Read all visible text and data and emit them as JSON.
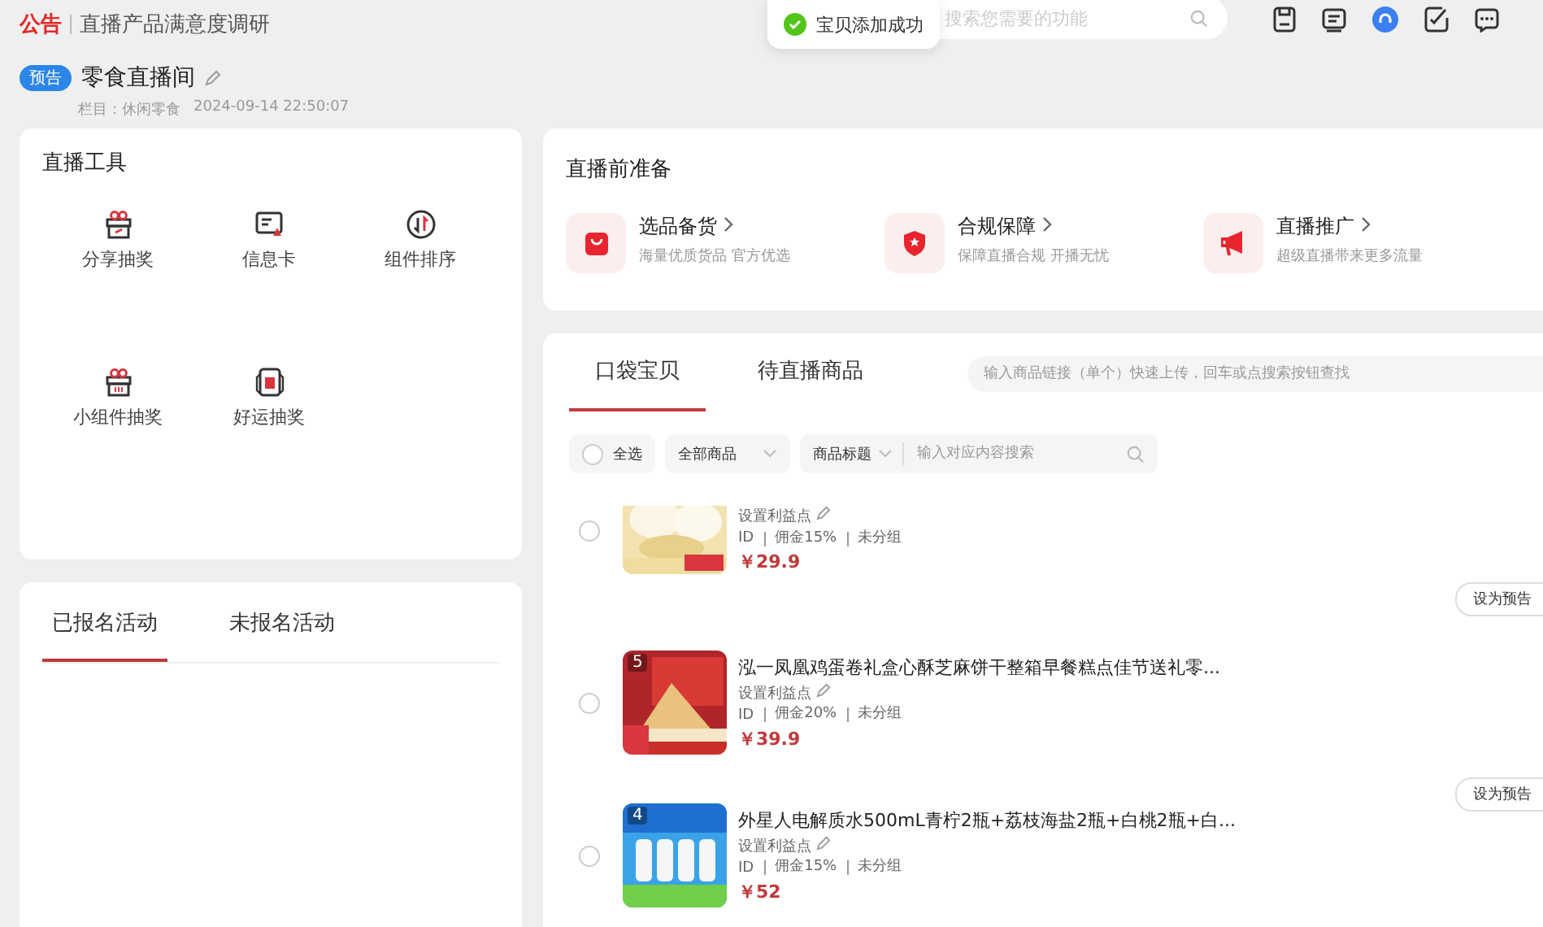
{
  "notice": {
    "tag": "公告",
    "text": "直播产品满意度调研"
  },
  "toast": {
    "text": "宝贝添加成功"
  },
  "search": {
    "placeholder": "搜索您需要的功能"
  },
  "toolbar_icons": [
    {
      "kind": "save"
    },
    {
      "kind": "message"
    },
    {
      "kind": "support"
    },
    {
      "kind": "edit"
    },
    {
      "kind": "chat"
    }
  ],
  "room": {
    "badge": "预告",
    "title": "零食直播间",
    "category": "栏目：休闲零食",
    "time": "2024-09-14 22:50:07"
  },
  "tools": {
    "title": "直播工具",
    "items": [
      {
        "kind": "gift",
        "label": "分享抽奖"
      },
      {
        "kind": "card",
        "label": "信息卡"
      },
      {
        "kind": "sort",
        "label": "组件排序"
      },
      {
        "kind": "gift2",
        "label": "小组件抽奖"
      },
      {
        "kind": "lucky",
        "label": "好运抽奖"
      }
    ]
  },
  "activities": {
    "tabs": [
      {
        "label": "已报名活动",
        "selected": true
      },
      {
        "label": "未报名活动",
        "selected": false
      }
    ]
  },
  "prep": {
    "title": "直播前准备",
    "items": [
      {
        "kind": "bag",
        "title": "选品备货",
        "desc": "海量优质货品 官方优选"
      },
      {
        "kind": "shield",
        "title": "合规保障",
        "desc": "保障直播合规 开播无忧"
      },
      {
        "kind": "megaphone",
        "title": "直播推广",
        "desc": "超级直播带来更多流量"
      }
    ]
  },
  "products": {
    "tabs": [
      {
        "label": "口袋宝贝",
        "selected": true
      },
      {
        "label": "待直播商品",
        "selected": false
      }
    ],
    "link_placeholder": "输入商品链接（单个）快速上传，回车或点搜索按钮查找",
    "select_all": {
      "label": "全选",
      "checked": false
    },
    "filter": "全部商品",
    "field": "商品标题",
    "search_placeholder": "输入对应内容搜索",
    "rows": [
      {
        "kind": "cut",
        "profit": "设置利益点",
        "id": "ID",
        "commission": "佣金15%",
        "group": "未分组",
        "price": "￥29.9",
        "checked": false,
        "button": "设为预告"
      },
      {
        "kind": "full",
        "number": "5",
        "title": "泓一凤凰鸡蛋卷礼盒心酥芝麻饼干整箱早餐糕点佳节送礼零...",
        "profit": "设置利益点",
        "id": "ID",
        "commission": "佣金20%",
        "group": "未分组",
        "price": "￥39.9",
        "checked": false,
        "button": "设为预告"
      },
      {
        "kind": "full",
        "number": "4",
        "title": "外星人电解质水500mL青柠2瓶+荔枝海盐2瓶+白桃2瓶+白...",
        "profit": "设置利益点",
        "id": "ID",
        "commission": "佣金15%",
        "group": "未分组",
        "price": "￥52",
        "checked": false
      }
    ]
  }
}
